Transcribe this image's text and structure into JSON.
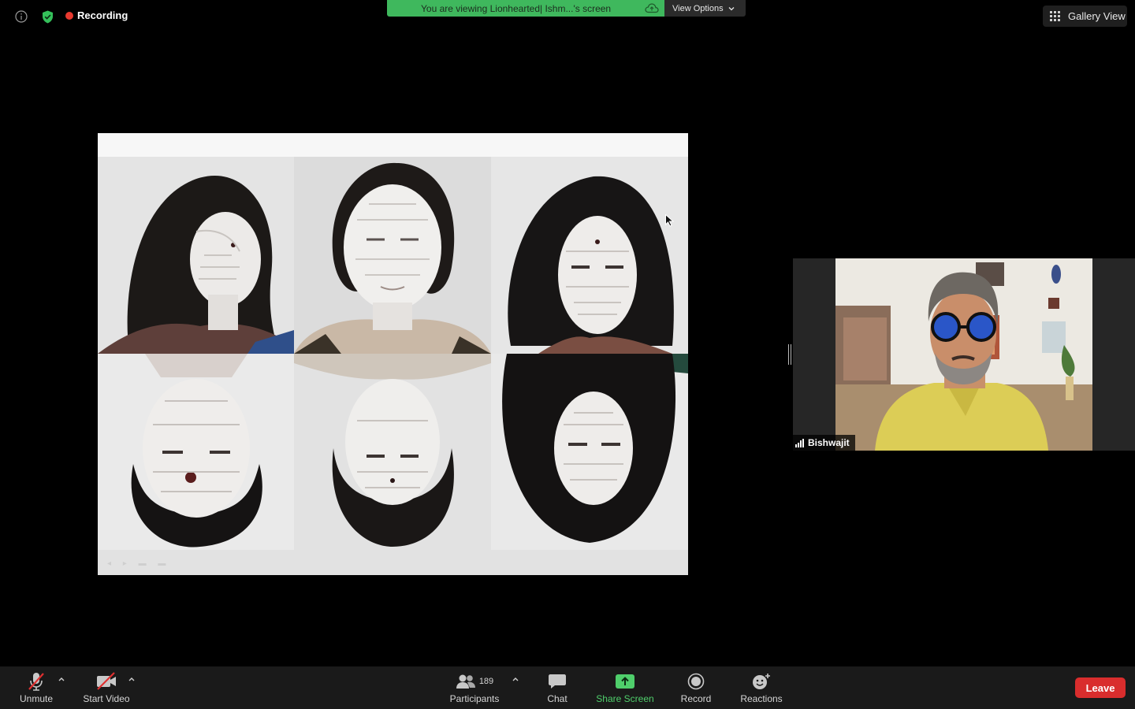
{
  "top_bar": {
    "recording_label": "Recording",
    "share_banner_text": "You are viewing Lionhearted| Ishm...'s screen",
    "view_options_label": "View Options",
    "gallery_view_label": "Gallery View"
  },
  "shared_screen": {
    "photos": [
      {
        "icon": "portrait-photo",
        "orientation": "upright"
      },
      {
        "icon": "portrait-photo",
        "orientation": "upright"
      },
      {
        "icon": "portrait-photo",
        "orientation": "upright"
      },
      {
        "icon": "portrait-photo",
        "orientation": "upside-down"
      },
      {
        "icon": "portrait-photo",
        "orientation": "upside-down"
      },
      {
        "icon": "portrait-photo",
        "orientation": "upside-down"
      }
    ]
  },
  "participant": {
    "name": "Bishwajit"
  },
  "toolbar": {
    "unmute_label": "Unmute",
    "start_video_label": "Start Video",
    "participants_label": "Participants",
    "participants_count": "189",
    "chat_label": "Chat",
    "share_screen_label": "Share Screen",
    "record_label": "Record",
    "reactions_label": "Reactions",
    "leave_label": "Leave"
  },
  "colors": {
    "share_banner": "#3fb85d",
    "share_screen_accent": "#4fce6b",
    "recording_dot": "#e8392f",
    "leave_button": "#d92d2d",
    "shield": "#34c05a"
  }
}
